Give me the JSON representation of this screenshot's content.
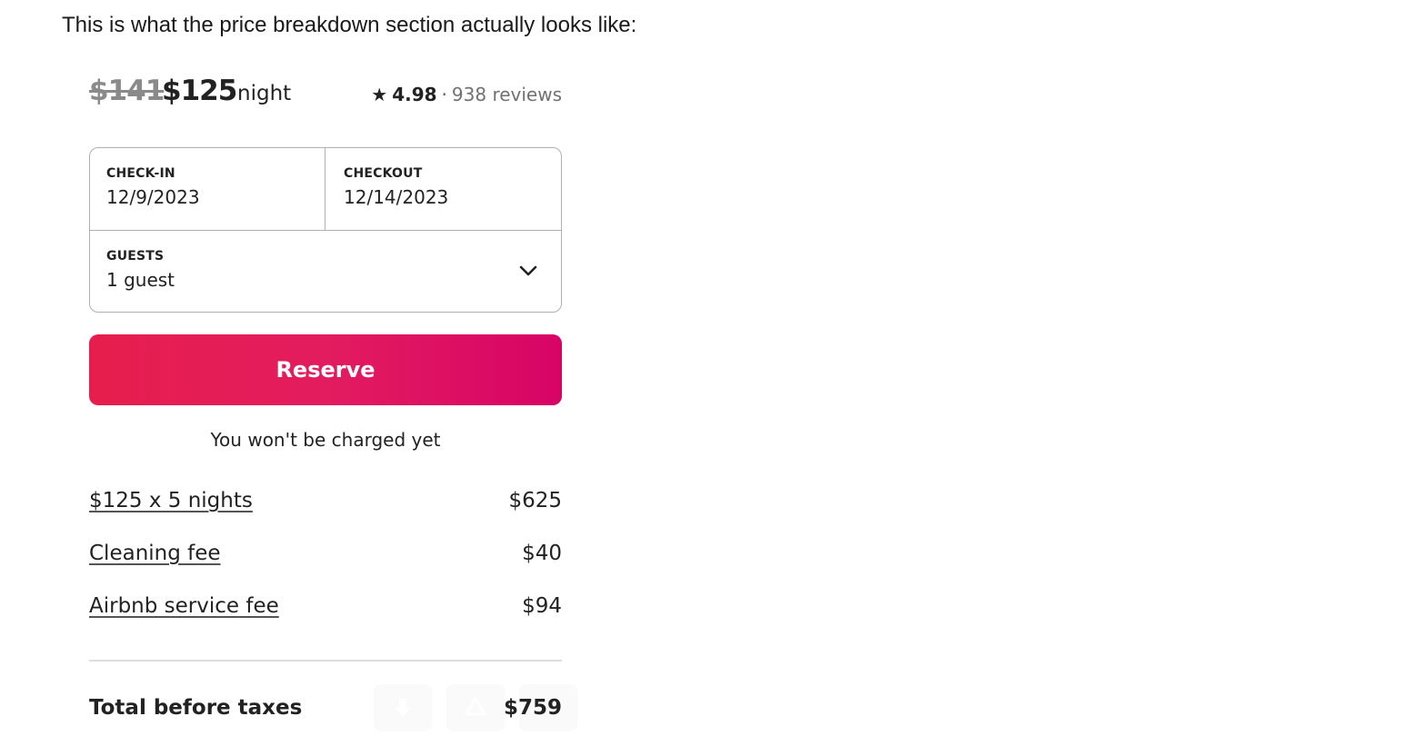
{
  "intro_text": "This is what the price breakdown section actually looks like:",
  "listing": {
    "original_price": "$141",
    "price": "$125",
    "per": "night",
    "rating": "4.98",
    "separator": "·",
    "reviews": "938 reviews",
    "star_icon": "★"
  },
  "booking": {
    "checkin": {
      "label": "CHECK-IN",
      "value": "12/9/2023"
    },
    "checkout": {
      "label": "CHECKOUT",
      "value": "12/14/2023"
    },
    "guests": {
      "label": "GUESTS",
      "value": "1 guest"
    },
    "reserve_label": "Reserve",
    "note": "You won't be charged yet"
  },
  "breakdown": [
    {
      "label": "$125 x 5 nights",
      "amount": "$625"
    },
    {
      "label": "Cleaning fee",
      "amount": "$40"
    },
    {
      "label": "Airbnb service fee",
      "amount": "$94"
    }
  ],
  "total": {
    "label": "Total before taxes",
    "amount": "$759"
  },
  "colors": {
    "brand_start": "#e61e4d",
    "brand_end": "#d70466",
    "text": "#222222",
    "muted": "#717171"
  }
}
